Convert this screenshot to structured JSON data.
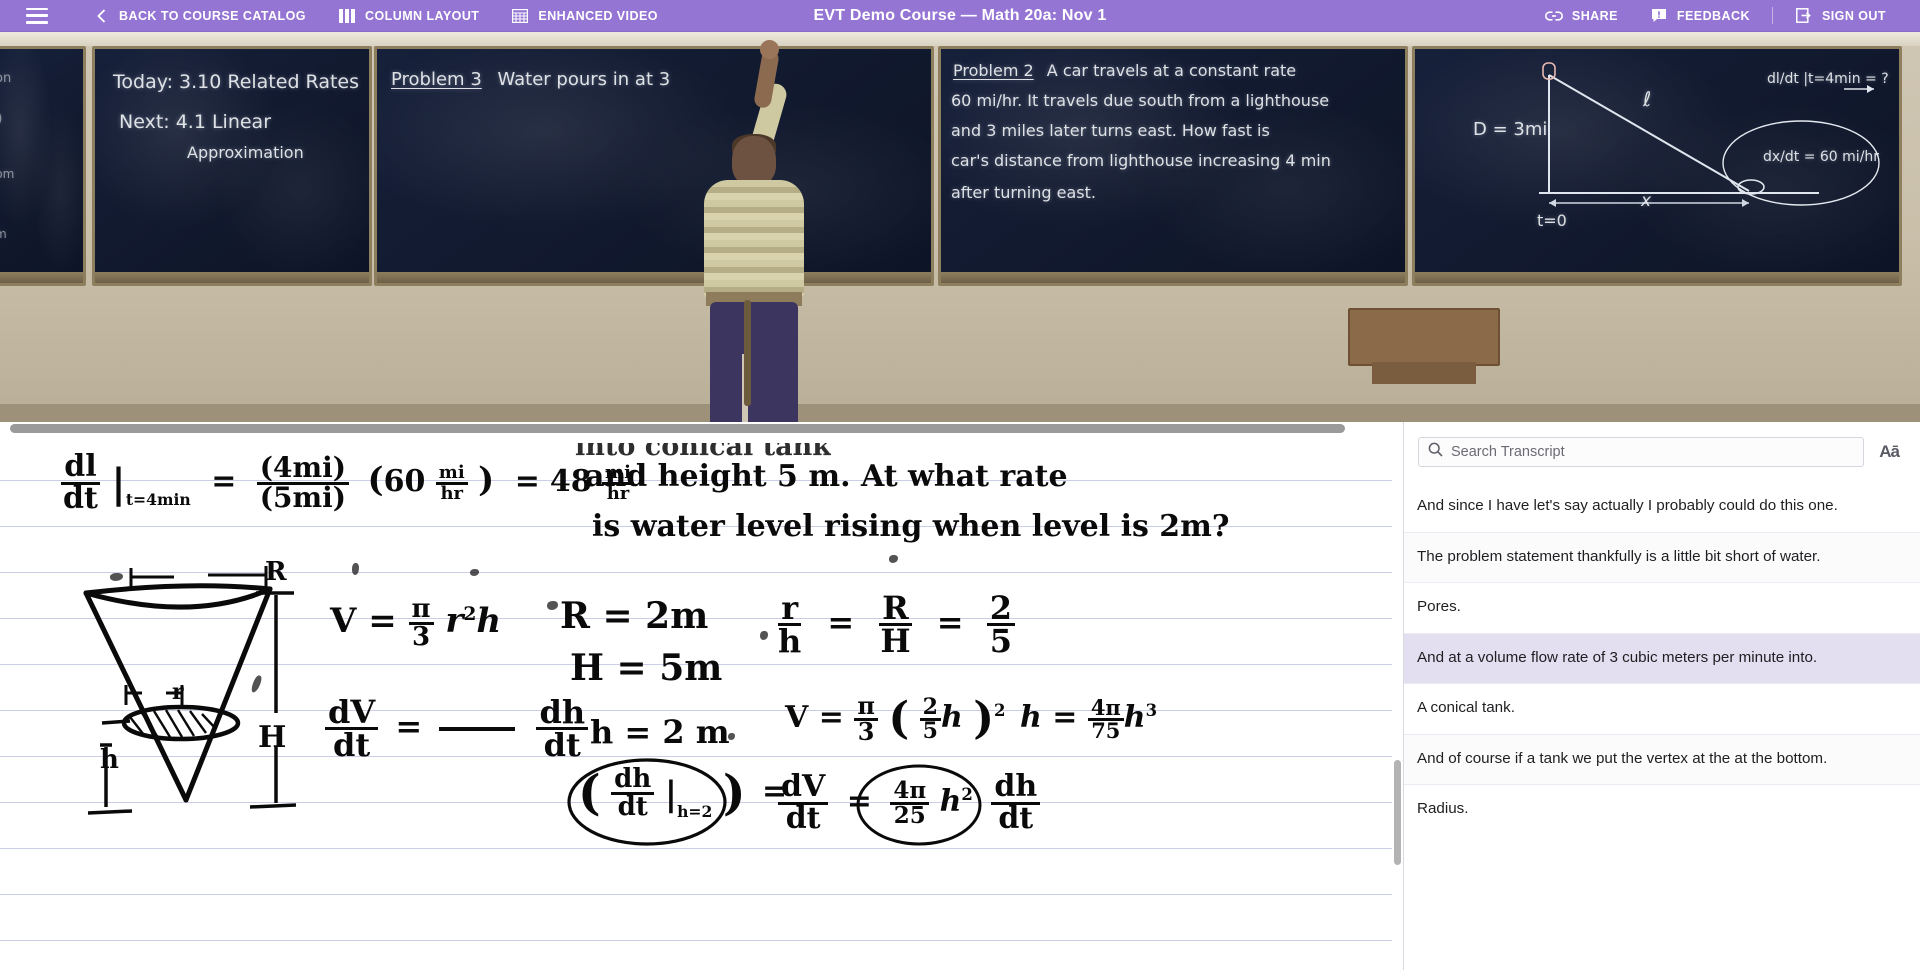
{
  "header": {
    "menu_icon": "hamburger-menu-icon",
    "back_label": "BACK TO COURSE CATALOG",
    "back_icon": "chevron-left-icon",
    "column_layout_label": "COLUMN LAYOUT",
    "column_layout_icon": "columns-icon",
    "enhanced_video_label": "ENHANCED VIDEO",
    "enhanced_video_icon": "grid-video-icon",
    "title": "EVT Demo Course — Math 20a: Nov 1",
    "share_label": "SHARE",
    "share_icon": "link-icon",
    "feedback_label": "FEEDBACK",
    "feedback_icon": "comment-icon",
    "signout_label": "SIGN OUT",
    "signout_icon": "exit-icon",
    "background_color": "#9575d4"
  },
  "video": {
    "board_left_partial_1": "on",
    "board_left_partial_2": ")",
    "board_left_partial_3": "pm",
    "board_left_partial_4": "m",
    "board2_line1": "Today: 3.10 Related Rates",
    "board2_line2": "Next: 4.1 Linear",
    "board2_line3": "Approximation",
    "board3_line1_label": "Problem 3",
    "board3_line1_text": "Water pours in at 3",
    "board4_line1_label": "Problem 2",
    "board4_line1_text": "A car travels at a constant rate",
    "board4_line2": "60 mi/hr.  It travels due south from a lighthouse",
    "board4_line3": "and 3 miles later turns east.  How fast is",
    "board4_line4": "car's distance from lighthouse increasing  4 min",
    "board4_line5": "after turning east.",
    "board5_D": "D = 3mi",
    "board5_l": "ℓ",
    "board5_x": "x",
    "board5_t0": "t=0",
    "board5_dldt": "dl/dt |t=4min = ?",
    "board5_dxdt": "dx/dt = 60 mi/hr"
  },
  "notes": {
    "eq_top_left": "dl/dt |t=4min = (4mi)/(5mi) (60 mi/hr) = 48 mi/hr",
    "cut_line": "into  conical  tank",
    "line_and_height": "and height  5 m.   At what rate",
    "line_is_water": "is water level rising when level is 2m?",
    "label_R": "R",
    "label_r": "r",
    "label_h": "h",
    "label_H": "H",
    "eq_volume": "V = π/3 r² h",
    "eq_dvdt": "dV/dt = ___ dh/dt",
    "eq_R2m": "R = 2m",
    "eq_H5m": "H = 5m",
    "eq_h2m": "h = 2 m",
    "eq_dhdt": "(dh/dt |h=2) =",
    "eq_ratio": "r/h = R/H = 2/5",
    "eq_V_sub": "V = π/3 (2/5 h)² h = 4π/75 h³",
    "eq_dVdt_final": "dV/dt = 4π/25 h² dh/dt"
  },
  "transcript": {
    "search_placeholder": "Search Transcript",
    "search_value": "",
    "search_icon": "search-icon",
    "font_size_label": "Aā",
    "highlight_color": "#e3dff0",
    "lines": [
      {
        "text": "And since I have let's say actually I probably could do this one.",
        "active": false
      },
      {
        "text": "The problem statement thankfully is a little bit short of water.",
        "active": false
      },
      {
        "text": "Pores.",
        "active": false
      },
      {
        "text": "And at a volume flow rate of 3 cubic meters per minute into.",
        "active": true
      },
      {
        "text": "A conical tank.",
        "active": false
      },
      {
        "text": "And of course if a tank we put the vertex at the at the bottom.",
        "active": false
      },
      {
        "text": "Radius.",
        "active": false
      }
    ]
  }
}
